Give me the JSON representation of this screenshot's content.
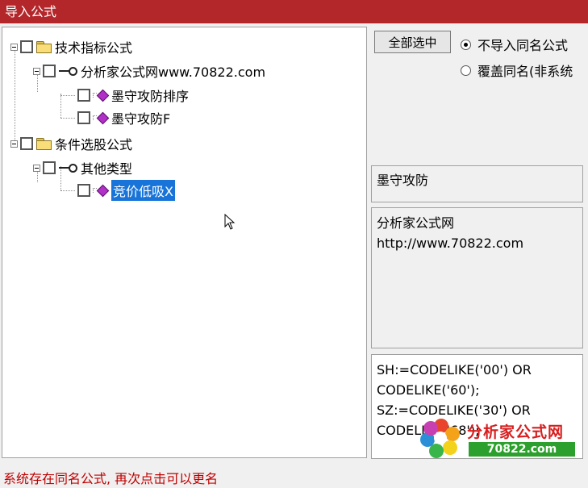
{
  "window": {
    "title": "导入公式"
  },
  "tree": {
    "nodes": [
      {
        "label": "技术指标公式"
      },
      {
        "label": "分析家公式网www.70822.com"
      },
      {
        "label": "墨守攻防排序"
      },
      {
        "label": "墨守攻防F"
      },
      {
        "label": "条件选股公式"
      },
      {
        "label": "其他类型"
      },
      {
        "label": "竞价低吸X"
      }
    ]
  },
  "controls": {
    "select_all_label": "全部选中",
    "radio_no_import_label": "不导入同名公式",
    "radio_overwrite_label": "覆盖同名(非系统",
    "radio_selected": "no_import"
  },
  "details": {
    "name": "墨守攻防",
    "description_lines": [
      "分析家公式网",
      "http://www.70822.com"
    ],
    "code_lines": [
      "SH:=CODELIKE('00') OR",
      "CODELIKE('60');",
      "SZ:=CODELIKE('30') OR",
      "CODELIKE('68');"
    ]
  },
  "status": {
    "message": "系统存在同名公式, 再次点击可以更名"
  },
  "logo": {
    "name": "分析家公式网",
    "url": "70822.com"
  }
}
